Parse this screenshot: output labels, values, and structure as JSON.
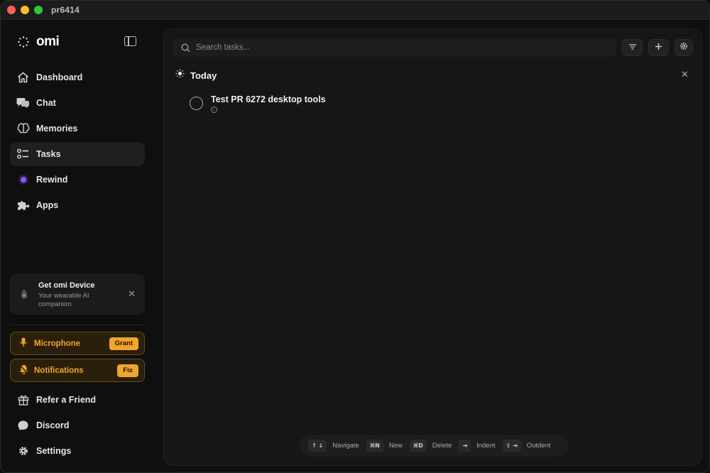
{
  "window": {
    "title": "pr6414"
  },
  "brand": {
    "name": "omi"
  },
  "nav": {
    "items": [
      {
        "label": "Dashboard",
        "icon": "home-icon"
      },
      {
        "label": "Chat",
        "icon": "chat-bubbles-icon"
      },
      {
        "label": "Memories",
        "icon": "brain-icon"
      },
      {
        "label": "Tasks",
        "icon": "checklist-icon",
        "active": true
      },
      {
        "label": "Rewind",
        "icon": "rewind-dot-icon"
      },
      {
        "label": "Apps",
        "icon": "puzzle-icon"
      }
    ]
  },
  "device_card": {
    "title": "Get omi Device",
    "subtitle": "Your wearable AI companion"
  },
  "permissions": {
    "microphone": {
      "label": "Microphone",
      "action": "Grant"
    },
    "notifications": {
      "label": "Notifications",
      "action": "Fix"
    }
  },
  "footer": {
    "refer": "Refer a Friend",
    "discord": "Discord",
    "settings": "Settings"
  },
  "search": {
    "placeholder": "Search tasks..."
  },
  "section": {
    "title": "Today"
  },
  "tasks": [
    {
      "title": "Test PR 6272 desktop tools"
    }
  ],
  "shortcuts": [
    {
      "keys": "↑ ↓",
      "label": "Navigate"
    },
    {
      "keys": "⌘N",
      "label": "New"
    },
    {
      "keys": "⌘D",
      "label": "Delete"
    },
    {
      "keys": "⇥",
      "label": "Indent"
    },
    {
      "keys": "⇧ ⇥",
      "label": "Outdent"
    }
  ],
  "colors": {
    "accent_warning": "#f0a52c",
    "rewind_dot": "#8b5cf6",
    "background": "#0f0f0f",
    "panel": "#161616"
  }
}
